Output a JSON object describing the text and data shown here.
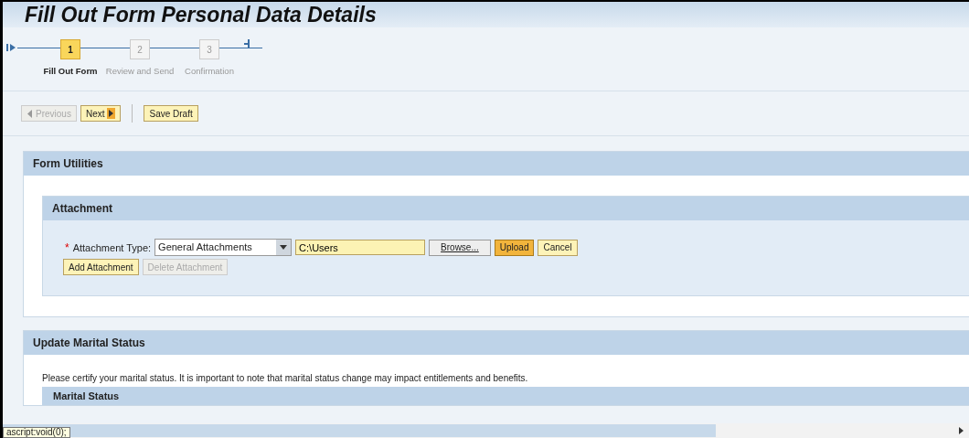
{
  "window": {
    "title": "Fill Out Form Personal Data Details"
  },
  "steps": [
    {
      "number": "1",
      "label": "Fill Out Form",
      "selected": true
    },
    {
      "number": "2",
      "label": "Review and Send",
      "selected": false
    },
    {
      "number": "3",
      "label": "Confirmation",
      "selected": false
    }
  ],
  "toolbar": [
    {
      "label": "Previous",
      "kind": "prev",
      "disabled": true
    },
    {
      "label": "Next",
      "kind": "next",
      "disabled": false
    },
    {
      "label": "Save Draft",
      "kind": "plain",
      "disabled": false
    }
  ],
  "form_utilities": {
    "title": "Form Utilities",
    "attachment": {
      "title": "Attachment",
      "required_mark": "*",
      "type_label": "Attachment Type:",
      "type_value": "General Attachments",
      "path_value": "C:\\Users",
      "buttons": [
        {
          "label": "Browse...",
          "kind": "browse",
          "disabled": false
        },
        {
          "label": "Upload",
          "kind": "emphasized",
          "disabled": false
        },
        {
          "label": "Cancel",
          "kind": "plain",
          "disabled": false
        }
      ],
      "row_buttons": [
        {
          "label": "Add Attachment",
          "disabled": false
        },
        {
          "label": "Delete Attachment",
          "disabled": true
        }
      ]
    }
  },
  "marital": {
    "title": "Update Marital Status",
    "note": "Please certify your marital status. It is important to note that marital status change may impact entitlements and benefits.",
    "table_title": "Marital Status"
  },
  "status_tip": "ascript:void(0);"
}
